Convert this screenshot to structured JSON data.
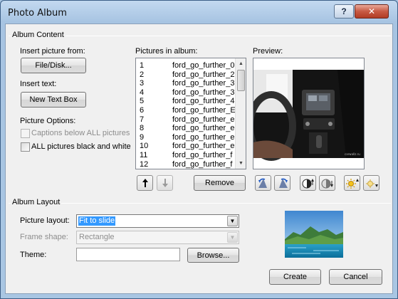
{
  "window": {
    "title": "Photo Album",
    "help_label": "?",
    "close_label": "✕"
  },
  "album_content": {
    "group_label": "Album Content",
    "insert_picture_label": "Insert picture from:",
    "file_disk_button": "File/Disk...",
    "insert_text_label": "Insert text:",
    "new_text_box_button": "New Text Box",
    "picture_options_label": "Picture Options:",
    "captions_label": "Captions below ALL pictures",
    "captions_checked": false,
    "black_white_label": "ALL pictures black and white",
    "black_white_checked": false
  },
  "pictures": {
    "label": "Pictures in album:",
    "items": [
      {
        "num": "1",
        "name": "ford_go_further_0"
      },
      {
        "num": "2",
        "name": "ford_go_further_2"
      },
      {
        "num": "3",
        "name": "ford_go_further_3"
      },
      {
        "num": "4",
        "name": "ford_go_further_3"
      },
      {
        "num": "5",
        "name": "ford_go_further_4"
      },
      {
        "num": "6",
        "name": "ford_go_further_E"
      },
      {
        "num": "7",
        "name": "ford_go_further_e"
      },
      {
        "num": "8",
        "name": "ford_go_further_e"
      },
      {
        "num": "9",
        "name": "ford_go_further_e"
      },
      {
        "num": "10",
        "name": "ford_go_further_e"
      },
      {
        "num": "11",
        "name": "ford_go_further_f"
      },
      {
        "num": "12",
        "name": "ford_go_further_f"
      }
    ],
    "remove_button": "Remove"
  },
  "preview": {
    "label": "Preview:",
    "watermark": "carwallz.ru"
  },
  "album_layout": {
    "group_label": "Album Layout",
    "picture_layout_label": "Picture layout:",
    "picture_layout_value": "Fit to slide",
    "frame_shape_label": "Frame shape:",
    "frame_shape_value": "Rectangle",
    "theme_label": "Theme:",
    "theme_value": "",
    "browse_button": "Browse..."
  },
  "footer": {
    "create_button": "Create",
    "cancel_button": "Cancel"
  },
  "colors": {
    "selection": "#3399ff",
    "title_bar": "#a9c6e3",
    "close_button": "#c75a43"
  }
}
